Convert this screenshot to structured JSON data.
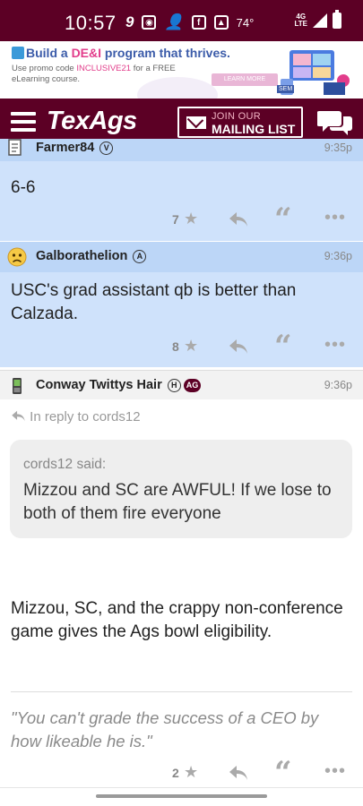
{
  "status_bar": {
    "time": "10:57",
    "temperature": "74°",
    "network": "4G LTE"
  },
  "ad": {
    "title_prefix": "Build a ",
    "title_highlight": "DE&I",
    "title_suffix": " program that thrives.",
    "sub_prefix": "Use promo code ",
    "promo_code": "INCLUSIVE21",
    "sub_suffix": " for a FREE eLearning course.",
    "cta": "LEARN MORE",
    "badge": "SEM"
  },
  "header": {
    "logo": "TexAgs",
    "join_label": "JOIN OUR",
    "mailing_label": "MAILING LIST"
  },
  "posts": [
    {
      "username": "Farmer84",
      "badge": "V",
      "time": "9:35p",
      "body": "6-6",
      "likes": "7"
    },
    {
      "username": "Galborathelion",
      "badge": "A",
      "time": "9:36p",
      "body": "USC's grad assistant qb is better than Calzada.",
      "likes": "8"
    },
    {
      "username": "Conway Twittys Hair",
      "badge": "H",
      "badge2": "AG",
      "time": "9:36p",
      "reply_to": "In reply to cords12",
      "quote_author": "cords12 said:",
      "quote_text": "Mizzou and SC are AWFUL! If we lose to both of them fire everyone",
      "body": "Mizzou, SC, and the crappy non-conference game gives the Ags bowl eligibility.",
      "signature": "\"You can't grade the success of a CEO by how likeable he is.\"",
      "likes": "2"
    }
  ],
  "colors": {
    "maroon": "#5c0025",
    "post_blue": "#cfe2fb",
    "post_head_blue": "#bcd6f7"
  }
}
